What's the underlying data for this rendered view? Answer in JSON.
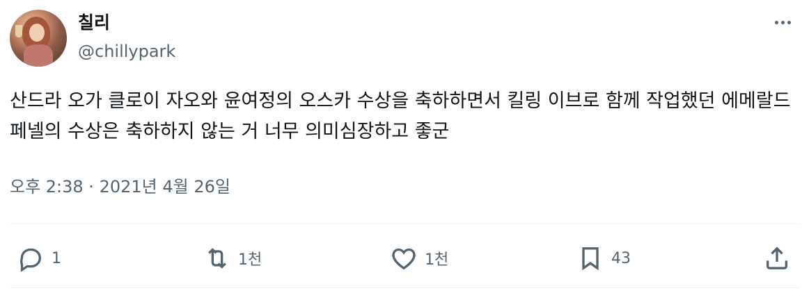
{
  "user": {
    "display_name": "칠리",
    "handle": "@chillypark"
  },
  "tweet": {
    "text": "산드라 오가 클로이 자오와 윤여정의 오스카 수상을 축하하면서 킬링 이브로 함께 작업했던 에메랄드 페넬의 수상은 축하하지 않는 거 너무 의미심장하고 좋군",
    "timestamp": "오후 2:38 · 2021년 4월 26일"
  },
  "actions": {
    "reply": {
      "icon": "reply-icon",
      "count": "1"
    },
    "retweet": {
      "icon": "retweet-icon",
      "count": "1천"
    },
    "like": {
      "icon": "heart-icon",
      "count": "1천"
    },
    "bookmark": {
      "icon": "bookmark-icon",
      "count": "43"
    },
    "share": {
      "icon": "share-icon"
    }
  },
  "colors": {
    "text": "#0f1419",
    "secondary": "#536471",
    "divider": "#eff3f4"
  }
}
